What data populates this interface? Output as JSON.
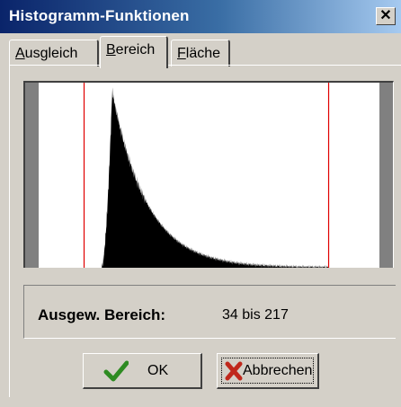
{
  "window": {
    "title": "Histogramm-Funktionen",
    "close_glyph": "✕"
  },
  "tabs": [
    {
      "label": "Ausgleich",
      "mnemonic": "A",
      "rest": "usgleich",
      "selected": false
    },
    {
      "label": "Bereich",
      "mnemonic": "B",
      "rest": "ereich",
      "selected": true
    },
    {
      "label": "Fläche",
      "mnemonic": "F",
      "rest": "läche",
      "selected": false
    }
  ],
  "histogram": {
    "range_min": 34,
    "range_max": 217,
    "domain_min": 0,
    "domain_max": 255,
    "peak_bin": 55,
    "marker_color": "#e00000",
    "bar_color": "#000000"
  },
  "range_info": {
    "label": "Ausgew. Bereich:",
    "value": "34 bis 217"
  },
  "buttons": {
    "ok_label": "OK",
    "ok_icon": "checkmark-icon",
    "cancel_label": "Abbrechen",
    "cancel_icon": "x-icon"
  },
  "colors": {
    "title_start": "#0a246a",
    "title_end": "#a6caf0",
    "face": "#d4d0c8",
    "ok_check": "#2e8b22",
    "cancel_x": "#c0281c"
  }
}
